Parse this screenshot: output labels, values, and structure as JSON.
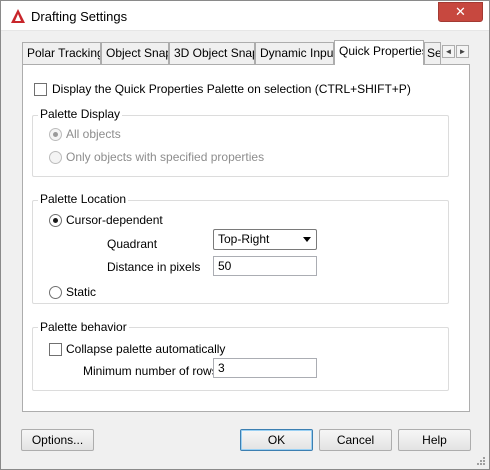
{
  "window": {
    "title": "Drafting Settings",
    "close_glyph": "✕"
  },
  "tabs": [
    {
      "label": "Polar Tracking"
    },
    {
      "label": "Object Snap"
    },
    {
      "label": "3D Object Snap"
    },
    {
      "label": "Dynamic Input"
    },
    {
      "label": "Quick Properties"
    },
    {
      "label": "Se"
    }
  ],
  "tab_scroll": {
    "left": "◄",
    "right": "►"
  },
  "display_palette": {
    "label": "Display the Quick Properties Palette on selection (CTRL+SHIFT+P)",
    "checked": false
  },
  "palette_display": {
    "title": "Palette Display",
    "all_objects": "All objects",
    "specified_objects": "Only objects with specified properties"
  },
  "palette_location": {
    "title": "Palette Location",
    "cursor_dependent": "Cursor-dependent",
    "quadrant_label": "Quadrant",
    "quadrant_value": "Top-Right",
    "distance_label": "Distance in pixels",
    "distance_value": "50",
    "static": "Static"
  },
  "palette_behavior": {
    "title": "Palette behavior",
    "collapse_label": "Collapse palette automatically",
    "min_rows_label": "Minimum number of rows",
    "min_rows_value": "3"
  },
  "footer": {
    "options": "Options...",
    "ok": "OK",
    "cancel": "Cancel",
    "help": "Help"
  },
  "colors": {
    "close_button": "#c7483f",
    "app_icon": "#c8262b",
    "panel_background": "#ffffff",
    "dialog_background": "#f0f0f0"
  }
}
